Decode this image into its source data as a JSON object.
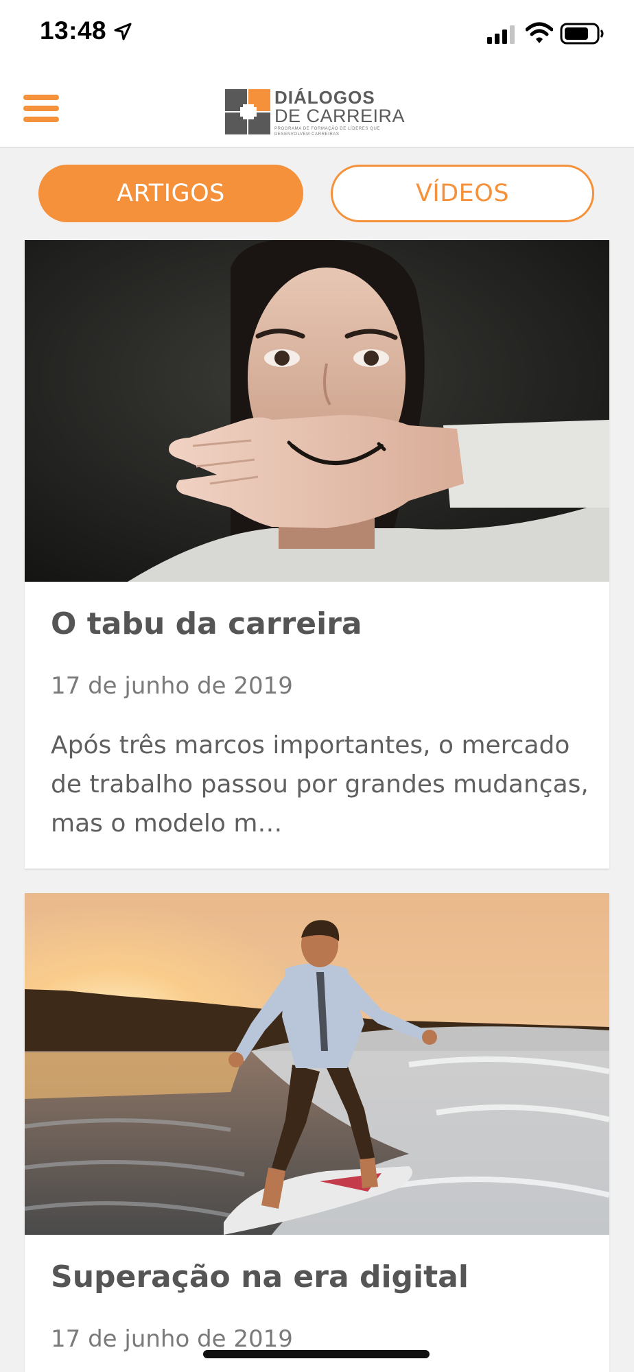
{
  "status_bar": {
    "time": "13:48",
    "icons": [
      "location-arrow-icon",
      "cellular-signal-icon",
      "wifi-icon",
      "battery-icon"
    ]
  },
  "header": {
    "menu_icon": "hamburger-menu-icon",
    "logo": {
      "title": "DIÁLOGOS",
      "subtitle": "DE CARREIRA",
      "tagline": "PROGRAMA DE FORMAÇÃO DE LÍDERES QUE DESENVOLVEM CARREIRAS"
    }
  },
  "tabs": [
    {
      "label": "ARTIGOS",
      "active": true
    },
    {
      "label": "VÍDEOS",
      "active": false
    }
  ],
  "articles": [
    {
      "title": "O tabu da carreira",
      "date": "17 de junho de 2019",
      "excerpt": "Após três marcos importantes, o mercado de trabalho passou por grandes mudanças, mas o modelo m…"
    },
    {
      "title": "Superação na era digital",
      "date": "17 de junho de 2019"
    }
  ],
  "colors": {
    "accent": "#f5913a",
    "text_dark": "#555555",
    "text_muted": "#7a7a7a",
    "background": "#f1f1f1"
  }
}
